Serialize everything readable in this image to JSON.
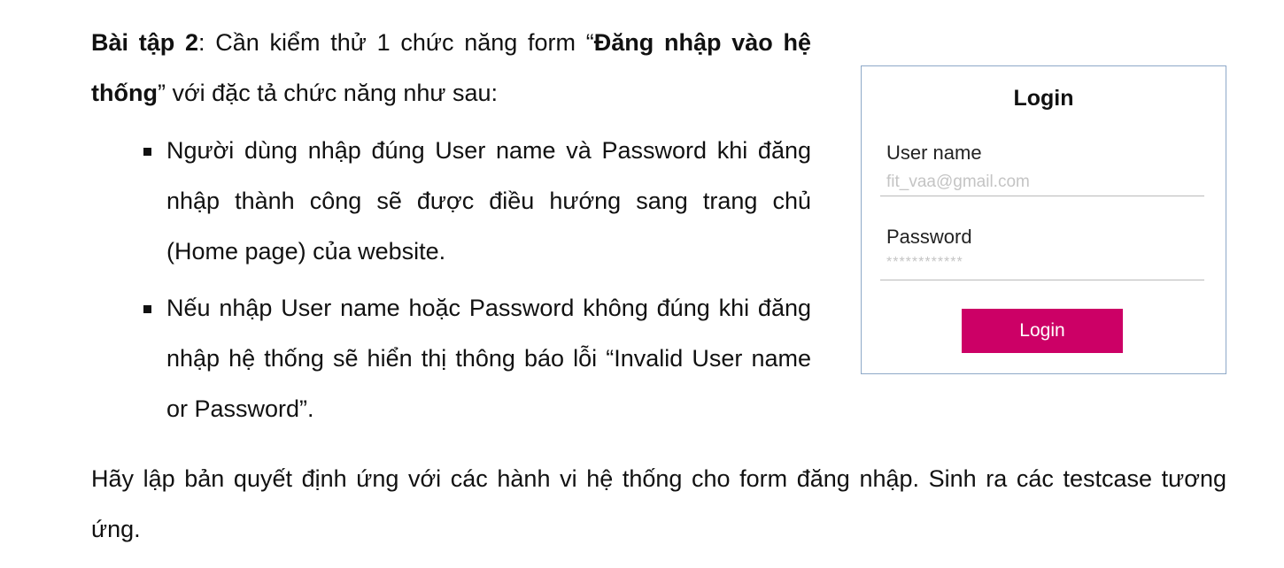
{
  "exercise": {
    "label": "Bài tập 2",
    "intro_prefix": ": Cần kiểm thử 1 chức năng form “",
    "feature_name": "Đăng nhập vào hệ thống",
    "intro_suffix": "” với đặc tả chức năng như sau:"
  },
  "spec_items": [
    "Người dùng nhập đúng User name và Password khi đăng nhập thành công sẽ được điều hướng sang trang chủ (Home page) của website.",
    "Nếu nhập User name hoặc Password không đúng khi đăng nhập hệ thống sẽ hiển thị thông báo lỗi “Invalid User name or Password”."
  ],
  "task": "Hãy lập bản quyết định ứng với các hành vi hệ thống cho form đăng nhập. Sinh ra các testcase tương ứng.",
  "login_form": {
    "title": "Login",
    "username_label": "User name",
    "username_value": "fit_vaa@gmail.com",
    "password_label": "Password",
    "password_value": "************",
    "button_label": "Login",
    "button_color": "#cc0066",
    "border_color": "#8ea9c8"
  }
}
